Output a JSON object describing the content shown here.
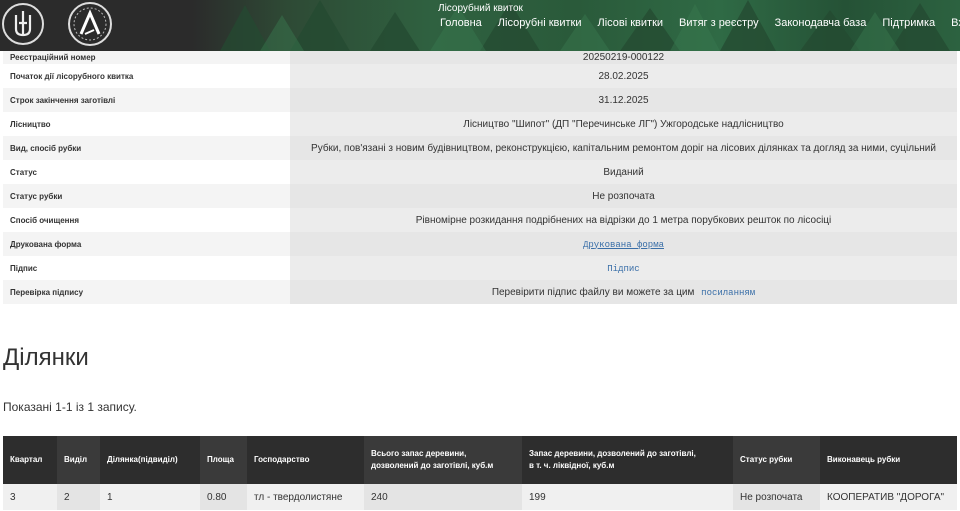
{
  "header": {
    "page_label": "Лісорубний квиток",
    "nav": [
      "Головна",
      "Лісорубні квитки",
      "Лісові квитки",
      "Витяг з реєстру",
      "Законодавча база",
      "Підтримка",
      "Вхід"
    ]
  },
  "details": [
    {
      "label": "Реєстраційний номер",
      "value": "20250219-000122"
    },
    {
      "label": "Початок дії лісорубного квитка",
      "value": "28.02.2025"
    },
    {
      "label": "Строк закінчення заготівлі",
      "value": "31.12.2025"
    },
    {
      "label": "Лісництво",
      "value": "Лісництво \"Шипот\" (ДП \"Перечинське ЛГ\") Ужгородське надлісництво"
    },
    {
      "label": "Вид, спосіб рубки",
      "value": "Рубки, пов'язані з новим будівництвом, реконструкцією, капітальним ремонтом доріг на лісових ділянках та догляд за ними, суцільний"
    },
    {
      "label": "Статус",
      "value": "Виданий"
    },
    {
      "label": "Статус рубки",
      "value": "Не розпочата"
    },
    {
      "label": "Спосіб очищення",
      "value": "Рівномірне розкидання подрібнених на відрізки до 1 метра порубкових решток по лісосіці"
    },
    {
      "label": "Друкована форма",
      "link": "Друкована форма"
    },
    {
      "label": "Підпис",
      "link": "Підпис"
    },
    {
      "label": "Перевірка підпису",
      "value": "Перевірити підпис файлу ви можете за цим",
      "link": "посиланням"
    }
  ],
  "section_title": "Ділянки",
  "summary": "Показані 1-1 із 1 запису.",
  "plots": {
    "columns": [
      "Квартал",
      "Виділ",
      "Ділянка(підвиділ)",
      "Площа",
      "Господарство",
      "Всього запас деревини,\nдозволений до заготівлі, куб.м",
      "Запас деревини, дозволений до заготівлі,\nв т. ч. ліквідної, куб.м",
      "Статус рубки",
      "Виконавець рубки"
    ],
    "rows": [
      [
        "3",
        "2",
        "1",
        "0.80",
        "тл - твердолистяне",
        "240",
        "199",
        "Не розпочата",
        "КООПЕРАТИВ \"ДОРОГА\""
      ]
    ]
  },
  "colors": {
    "header_dark": "#2b2b2b",
    "header_green": "#2f6140",
    "link": "#3a6fa8",
    "table_header": "#2d2d2d"
  }
}
